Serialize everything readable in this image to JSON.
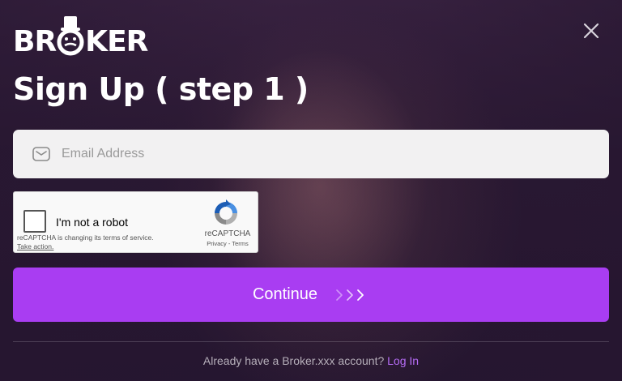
{
  "logo": {
    "text_before": "BR",
    "text_after": "KER"
  },
  "title": "Sign Up ( step 1 )",
  "email": {
    "placeholder": "Email Address",
    "value": ""
  },
  "recaptcha": {
    "label": "I'm not a robot",
    "notice": "reCAPTCHA is changing its terms of service.",
    "notice_link": "Take action.",
    "brand": "reCAPTCHA",
    "privacy": "Privacy",
    "separator": " - ",
    "terms": "Terms"
  },
  "continue_label": "Continue",
  "footer": {
    "text": "Already have a Broker.xxx account? ",
    "login": "Log In"
  },
  "colors": {
    "accent": "#a93df2",
    "link": "#b56cf5"
  },
  "icons": [
    "hat-mascot-icon",
    "close-icon",
    "mail-icon",
    "recaptcha-logo-icon",
    "chevron-arrows-icon"
  ]
}
